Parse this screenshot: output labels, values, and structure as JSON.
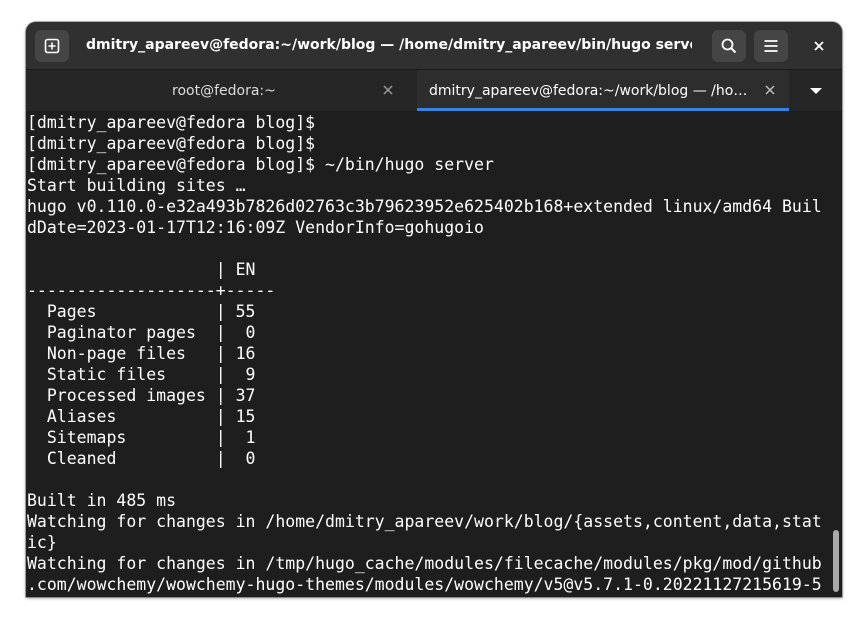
{
  "window": {
    "title": "dmitry_apareev@fedora:~/work/blog — /home/dmitry_apareev/bin/hugo server"
  },
  "headerbar": {
    "new_tab_icon": "new-tab-icon",
    "search_icon": "search-icon",
    "menu_icon": "hamburger-menu-icon",
    "close_icon": "close-icon"
  },
  "tabs": [
    {
      "label": "root@fedora:~",
      "active": false
    },
    {
      "label": "dmitry_apareev@fedora:~/work/blog — /home/dmitry_apareev/bin/hugo server",
      "active": true
    }
  ],
  "tab_overflow_icon": "chevron-down-icon",
  "terminal": {
    "lines": [
      "[dmitry_apareev@fedora blog]$ ",
      "[dmitry_apareev@fedora blog]$ ",
      "[dmitry_apareev@fedora blog]$ ~/bin/hugo server",
      "Start building sites … ",
      "hugo v0.110.0-e32a493b7826d02763c3b79623952e625402b168+extended linux/amd64 Buil",
      "dDate=2023-01-17T12:16:09Z VendorInfo=gohugoio",
      "",
      "                   | EN  ",
      "-------------------+-----",
      "  Pages            | 55  ",
      "  Paginator pages  |  0  ",
      "  Non-page files   | 16  ",
      "  Static files     |  9  ",
      "  Processed images | 37  ",
      "  Aliases          | 15  ",
      "  Sitemaps         |  1  ",
      "  Cleaned          |  0  ",
      "",
      "Built in 485 ms",
      "Watching for changes in /home/dmitry_apareev/work/blog/{assets,content,data,stat",
      "ic}",
      "Watching for changes in /tmp/hugo_cache/modules/filecache/modules/pkg/mod/github",
      ".com/wowchemy/wowchemy-hugo-themes/modules/wowchemy/v5@v5.7.1-0.20221127215619-5"
    ]
  },
  "colors": {
    "background": "#1e1e1e",
    "headerbar": "#303030",
    "tabbar": "#262626",
    "accent": "#3584e4",
    "text": "#ffffff"
  }
}
